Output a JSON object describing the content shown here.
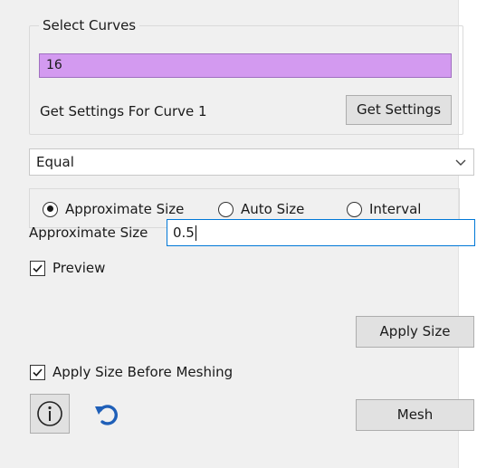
{
  "select_curves": {
    "title": "Select Curves",
    "value": "16",
    "field_color": "#d39af0",
    "get_settings_label": "Get Settings For Curve 1",
    "get_settings_button": "Get Settings"
  },
  "distribution": {
    "selected": "Equal"
  },
  "size_mode": {
    "options": [
      {
        "label": "Approximate Size",
        "checked": true
      },
      {
        "label": "Auto Size",
        "checked": false
      },
      {
        "label": "Interval",
        "checked": false
      }
    ]
  },
  "approximate_size": {
    "label": "Approximate Size",
    "value": "0.5"
  },
  "preview": {
    "label": "Preview",
    "checked": true
  },
  "apply_size_button": "Apply Size",
  "apply_before_meshing": {
    "label": "Apply Size Before Meshing",
    "checked": true
  },
  "icons": {
    "info": "info-icon",
    "undo": "undo-icon",
    "undo_color": "#1f5fb8"
  },
  "mesh_button": "Mesh"
}
